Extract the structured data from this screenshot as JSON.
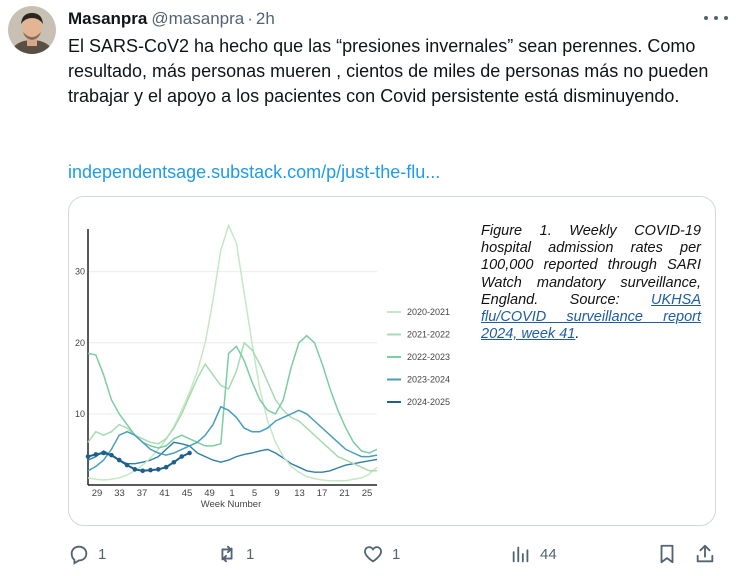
{
  "tweet": {
    "author_name": "Masanpra",
    "handle": "@masanpra",
    "separator": "·",
    "time": "2h",
    "text": "El SARS-CoV2 ha hecho que las “presiones invernales” sean perennes. Como resultado, más personas mueren , cientos de miles de personas más no pueden trabajar y el apoyo a los pacientes con Covid persistente está disminuyendo.",
    "link": "independentsage.substack.com/p/just-the-flu..."
  },
  "figure": {
    "caption_main": "Figure 1. Weekly COVID-19 hospital admission rates per 100,000 reported through SARI Watch mandatory surveillance, England. Source: ",
    "caption_link": "UKHSA flu/COVID surveillance report 2024, week 41",
    "caption_end": "."
  },
  "actions": {
    "replies": "1",
    "reposts": "1",
    "likes": "1",
    "views": "44"
  },
  "chart_data": {
    "type": "line",
    "xlabel": "Week Number",
    "ylabel": "",
    "x_ticks": [
      "29",
      "33",
      "37",
      "41",
      "45",
      "49",
      "1",
      "5",
      "9",
      "13",
      "17",
      "21",
      "25"
    ],
    "y_ticks": [
      10,
      20,
      30
    ],
    "ylim": [
      0,
      36
    ],
    "legend_position": "right",
    "grid": true,
    "series": [
      {
        "name": "2020-2021",
        "color": "#c4e8c4",
        "values": [
          1.0,
          0.8,
          0.7,
          0.8,
          1.0,
          1.4,
          2.0,
          2.8,
          3.8,
          5.0,
          6.4,
          8.2,
          10.5,
          13.0,
          16.0,
          20.0,
          26.0,
          33.0,
          36.5,
          34.0,
          27.0,
          20.0,
          13.5,
          9.0,
          6.0,
          4.0,
          2.6,
          1.8,
          1.2,
          0.9,
          0.7,
          0.6,
          0.6,
          0.6,
          0.8,
          1.0,
          1.5,
          2.5
        ]
      },
      {
        "name": "2021-2022",
        "color": "#a6dcae",
        "values": [
          6.0,
          7.5,
          7.0,
          7.5,
          8.5,
          8.0,
          7.0,
          6.5,
          6.0,
          5.8,
          6.5,
          8.0,
          10.0,
          12.5,
          15.0,
          17.0,
          15.5,
          14.0,
          13.5,
          16.0,
          20.0,
          19.0,
          17.0,
          14.5,
          12.0,
          10.5,
          9.5,
          9.0,
          8.0,
          7.0,
          6.0,
          5.0,
          4.0,
          3.5,
          3.0,
          2.5,
          2.0,
          2.0
        ]
      },
      {
        "name": "2022-2023",
        "color": "#7ccda3",
        "values": [
          18.5,
          18.3,
          15.5,
          12.0,
          10.0,
          8.5,
          7.0,
          6.0,
          5.5,
          5.2,
          5.5,
          6.5,
          7.0,
          6.5,
          6.0,
          5.5,
          5.5,
          5.8,
          18.5,
          19.5,
          17.5,
          14.5,
          12.0,
          10.5,
          10.0,
          12.0,
          16.5,
          20.0,
          21.0,
          20.0,
          17.0,
          13.5,
          10.5,
          8.0,
          6.0,
          4.8,
          4.5,
          5.0
        ]
      },
      {
        "name": "2023-2024",
        "color": "#4a9ebd",
        "values": [
          2.0,
          2.6,
          3.5,
          5.0,
          7.0,
          7.5,
          7.0,
          6.0,
          5.0,
          4.5,
          4.2,
          4.5,
          5.0,
          5.5,
          6.0,
          7.0,
          8.5,
          11.0,
          10.5,
          9.5,
          8.0,
          7.5,
          7.5,
          8.0,
          9.0,
          9.5,
          10.0,
          10.5,
          10.0,
          9.0,
          8.0,
          7.0,
          6.0,
          5.0,
          4.5,
          4.0,
          4.0,
          4.2
        ]
      },
      {
        "name": "2024-2025",
        "color": "#1f5f8b",
        "values": [
          4.0,
          4.3,
          4.5,
          4.2,
          3.5,
          2.8,
          2.2,
          2.0,
          2.1,
          2.2,
          2.5,
          3.2,
          4.0,
          4.5
        ]
      }
    ],
    "extra_line": {
      "name": "",
      "color": "#2f7fa6",
      "values": [
        3.5,
        4.0,
        4.8,
        4.2,
        3.5,
        3.0,
        3.0,
        3.2,
        3.5,
        4.0,
        5.0,
        6.0,
        5.8,
        5.5,
        4.5,
        4.0,
        3.5,
        3.2,
        3.5,
        4.0,
        4.3,
        4.5,
        4.8,
        5.0,
        4.5,
        3.8,
        3.0,
        2.5,
        2.0,
        1.8,
        1.8,
        2.0,
        2.4,
        2.8,
        3.0,
        3.2,
        3.4,
        3.6
      ]
    }
  }
}
